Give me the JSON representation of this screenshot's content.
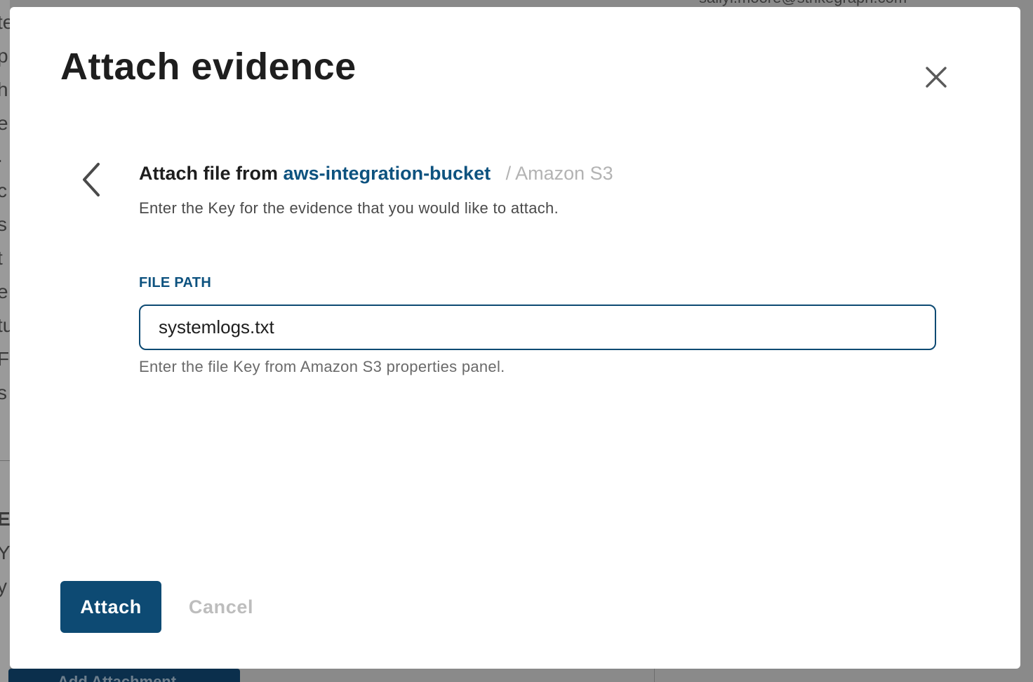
{
  "background": {
    "left_edge_chars": [
      "te",
      "p",
      "h",
      "e",
      ".",
      "c",
      "s",
      "t",
      "e",
      "tu",
      "F",
      "s",
      "E",
      "Y",
      "y"
    ],
    "email": "sallyl.moore@strikegraph.com",
    "bottom_button_label": "Add Attachment"
  },
  "modal": {
    "title": "Attach evidence",
    "heading_prefix": "Attach file from",
    "bucket_name": "aws-integration-bucket",
    "service_label": "/ Amazon S3",
    "description": "Enter the Key for the evidence that you would like to attach.",
    "file_path": {
      "label": "FILE PATH",
      "value": "systemlogs.txt",
      "help": "Enter the file Key from Amazon S3 properties panel."
    },
    "actions": {
      "attach_label": "Attach",
      "cancel_label": "Cancel"
    }
  },
  "colors": {
    "accent": "#0d4a73",
    "link": "#0d527f",
    "title": "#1e1e1e",
    "muted": "#b3b3b3",
    "overlay": "#8a8a8a"
  }
}
